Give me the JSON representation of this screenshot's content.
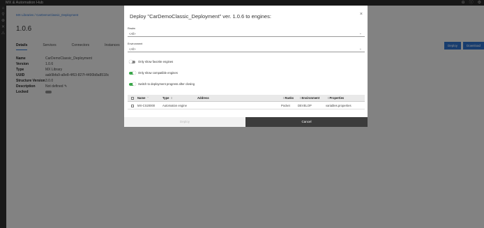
{
  "app": {
    "title": "MX & Automation Hub"
  },
  "topbar": {
    "icons": [
      "user-icon",
      "help-icon",
      "settings-icon"
    ],
    "glyphs": [
      "⊖",
      "ⓘ",
      "⚙"
    ]
  },
  "rail": {
    "glyphs": [
      "⌂",
      "⚲",
      "⊕",
      "✕",
      "⚠"
    ]
  },
  "page": {
    "breadcrumb": "MX Libraries / CarDemoClassic_Deployment",
    "version": "1.0.6",
    "tabs": [
      "Details",
      "Services",
      "Connectors",
      "Instances"
    ],
    "details": [
      {
        "key": "Name",
        "value": "CarDemoClassic_Deployment"
      },
      {
        "key": "Version",
        "value": "1.0.6"
      },
      {
        "key": "Type",
        "value": "MX Library"
      },
      {
        "key": "UUID",
        "value": "aab9bfa9-a8e8-4f63-827f-4490b8a8518c"
      },
      {
        "key": "Structure Version",
        "value": "3.0.0"
      },
      {
        "key": "Description",
        "value": "Not defined ✎"
      },
      {
        "key": "Locked",
        "value": ""
      }
    ],
    "deploy_label": "Deploy",
    "download_label": "Download"
  },
  "dialog": {
    "title": "Deploy \"CarDemoClassic_Deployment\" ver. 1.0.6 to engines:",
    "close": "×",
    "realm_label": "Realm",
    "realm_value": "<All>",
    "environment_label": "Environment",
    "environment_value": "<All>",
    "switches": [
      {
        "label": "Only show favorite engines",
        "on": false
      },
      {
        "label": "Only show compatible engines",
        "on": true
      },
      {
        "label": "Switch to deployment progress after closing",
        "on": true
      }
    ],
    "table": {
      "headers": [
        "Name",
        "Type",
        "Address",
        "Ranks",
        "Environment",
        "Properties"
      ],
      "rows": [
        {
          "name": "MX-CS20000",
          "type": "Automation engine",
          "address": "",
          "ranks": "Pocket",
          "environment": "DEVELOP",
          "properties": "variables.properties"
        }
      ]
    },
    "deploy_label": "Deploy",
    "cancel_label": "Cancel"
  },
  "colors": {
    "accent": "#2d6fc9",
    "switch_on": "#3aa84a",
    "cancel_bg": "#3c3c3c"
  }
}
